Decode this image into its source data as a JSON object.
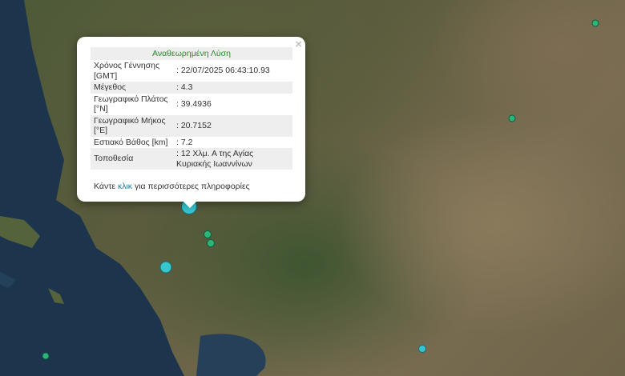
{
  "popup": {
    "title": "Αναθεωρημένη Λύση",
    "close": "×",
    "rows": [
      {
        "label": "Χρόνος Γέννησης [GMT]",
        "value": ": 22/07/2025 06:43:10.93"
      },
      {
        "label": "Μέγεθος",
        "value": ": 4.3"
      },
      {
        "label": "Γεωγραφικό Πλάτος [°N]",
        "value": ": 39.4936"
      },
      {
        "label": "Γεωγραφικό Μήκος [°E]",
        "value": ": 20.7152"
      },
      {
        "label": "Εστιακό Βάθος [km]",
        "value": ": 7.2"
      },
      {
        "label": "Τοποθεσία",
        "value": ": 12 Χλμ. Α της Αγίας Κυριακής Ιωαννίνων"
      }
    ],
    "more_prefix": "Κάντε ",
    "more_link": "κλικ",
    "more_suffix": " για περισσότερες πληροφορίες"
  },
  "colors": {
    "green_marker": "#2bb673",
    "cyan_marker": "#35c6cf",
    "sea": "#1c344c"
  }
}
